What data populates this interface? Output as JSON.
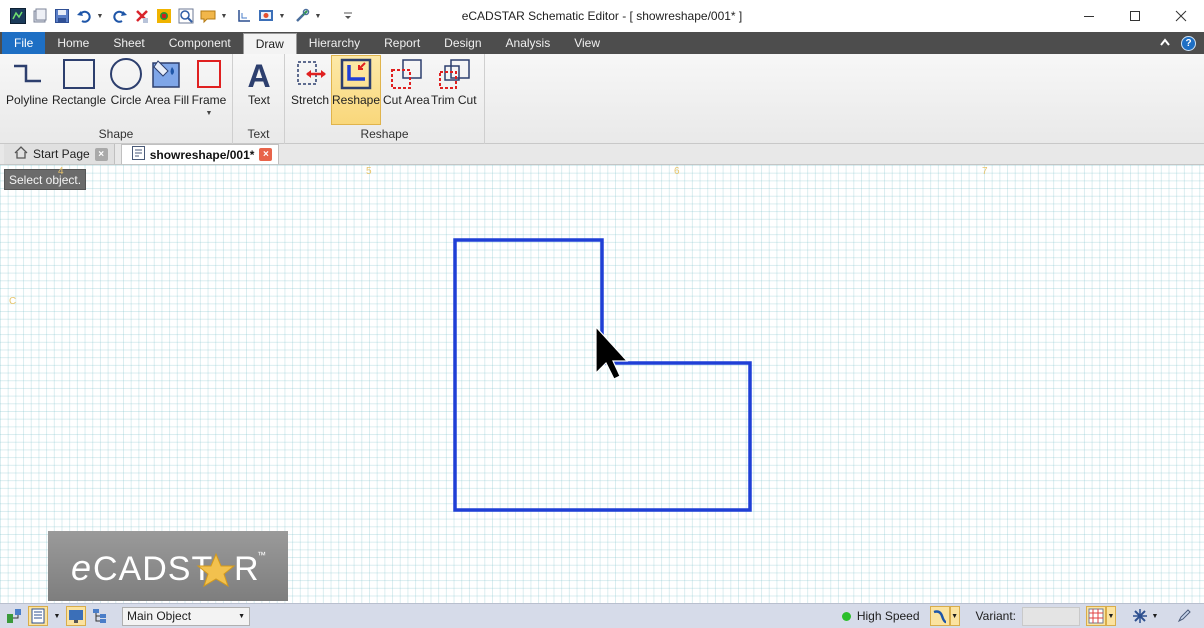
{
  "window": {
    "title": "eCADSTAR Schematic Editor - [ showreshape/001* ]",
    "quick_access_icons": [
      "app-logo-icon",
      "open-folder-icon",
      "save-icon",
      "undo-icon",
      "redo-icon",
      "delete-icon",
      "component-icon",
      "zoom-icon",
      "comment-icon",
      "axis-icon",
      "display-icon",
      "tools-icon",
      "customize-icon"
    ]
  },
  "ribbon": {
    "tabs": [
      {
        "label": "File",
        "kind": "file"
      },
      {
        "label": "Home",
        "kind": "normal"
      },
      {
        "label": "Sheet",
        "kind": "normal"
      },
      {
        "label": "Component",
        "kind": "normal"
      },
      {
        "label": "Draw",
        "kind": "active"
      },
      {
        "label": "Hierarchy",
        "kind": "normal"
      },
      {
        "label": "Report",
        "kind": "normal"
      },
      {
        "label": "Design",
        "kind": "normal"
      },
      {
        "label": "Analysis",
        "kind": "normal"
      },
      {
        "label": "View",
        "kind": "normal"
      }
    ],
    "groups": {
      "shape": {
        "label": "Shape",
        "buttons": {
          "polyline": "Polyline",
          "rectangle": "Rectangle",
          "circle": "Circle",
          "area_fill": "Area Fill",
          "frame": "Frame"
        }
      },
      "text": {
        "label": "Text",
        "buttons": {
          "text": "Text"
        }
      },
      "reshape": {
        "label": "Reshape",
        "buttons": {
          "stretch": "Stretch",
          "reshape": "Reshape",
          "cut_area": "Cut Area",
          "trim_cut": "Trim Cut"
        },
        "selected": "Reshape"
      }
    }
  },
  "doc_tabs": [
    {
      "label": "Start Page",
      "active": false
    },
    {
      "label": "showreshape/001*",
      "active": true
    }
  ],
  "canvas": {
    "tooltip": "Select object.",
    "ruler_marks": {
      "top": [
        "4",
        "5",
        "6",
        "7"
      ],
      "left": [
        "C"
      ]
    },
    "shape_color": "#1f3fd6",
    "logo_text": "eCADSTAR",
    "logo_tm": "™"
  },
  "statusbar": {
    "object_select": "Main Object",
    "speed_label": "High Speed",
    "speed_color": "#2bbf2b",
    "variant_label": "Variant:"
  },
  "colors": {
    "accent": "#1e6fc4",
    "tab_bar": "#4d4d4d",
    "selected_button": "#f9d77b"
  }
}
